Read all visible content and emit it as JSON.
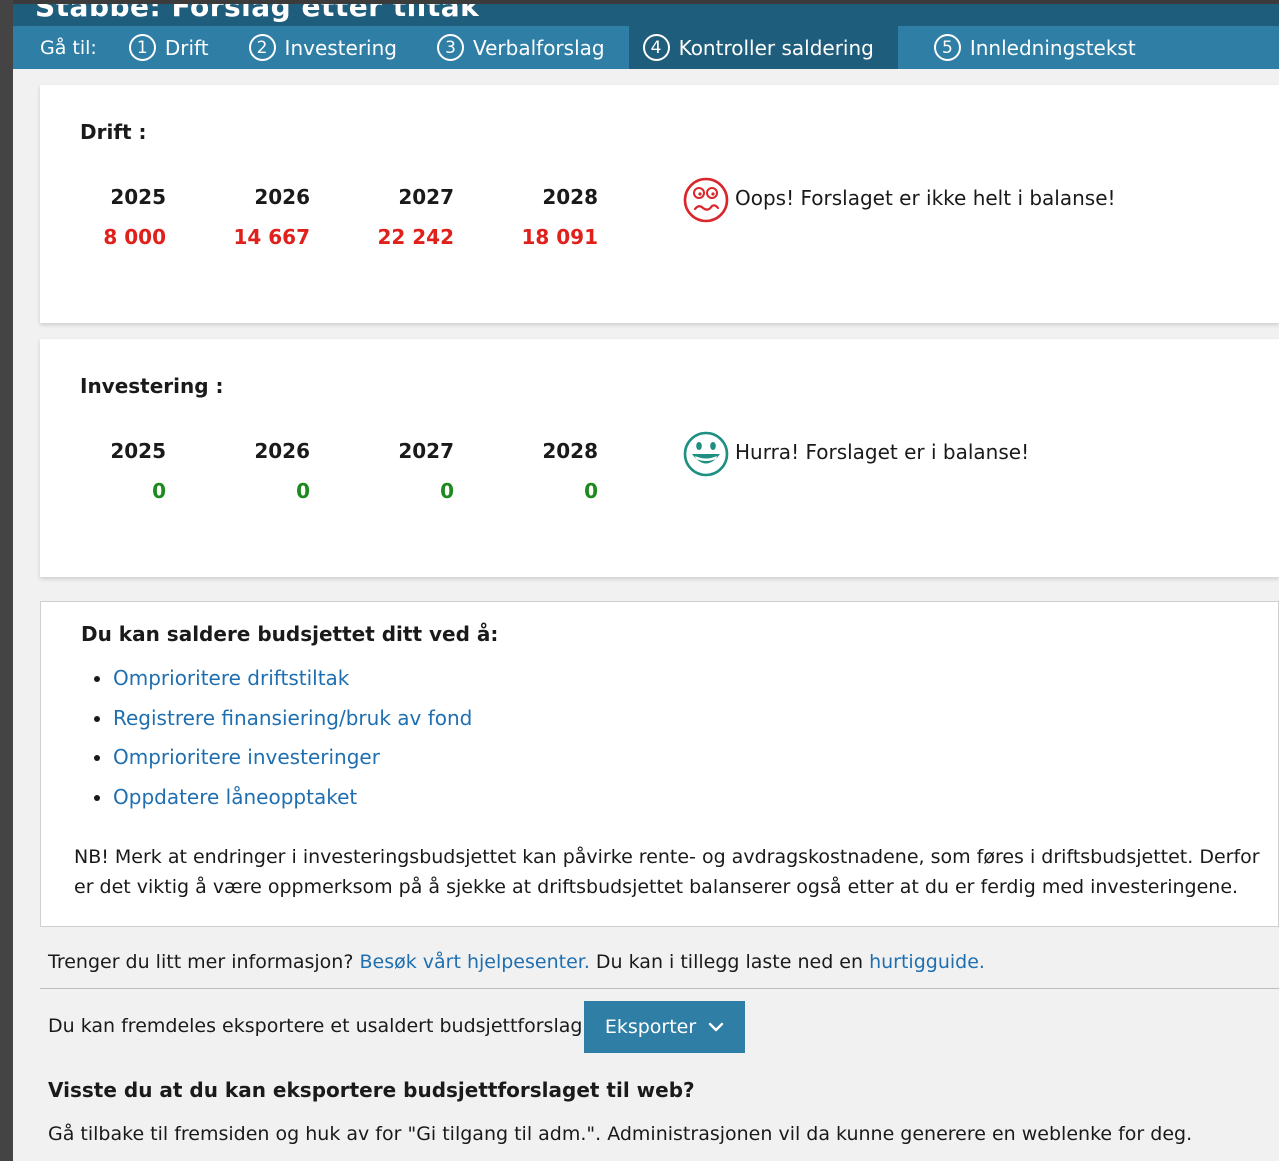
{
  "header": {
    "title": "Stabbe: Forslag etter tiltak"
  },
  "nav": {
    "goto_label": "Gå til:",
    "items": [
      {
        "num": "1",
        "label": "Drift"
      },
      {
        "num": "2",
        "label": "Investering"
      },
      {
        "num": "3",
        "label": "Verbalforslag"
      },
      {
        "num": "4",
        "label": "Kontroller saldering"
      },
      {
        "num": "5",
        "label": "Innledningstekst"
      }
    ],
    "active_index": 3
  },
  "drift": {
    "title": "Drift :",
    "years": [
      "2025",
      "2026",
      "2027",
      "2028"
    ],
    "values": [
      "8 000",
      "14 667",
      "22 242",
      "18 091"
    ],
    "value_color": "#e0201b",
    "status_icon": "sad-face-icon",
    "status_text": "Oops! Forslaget er ikke helt i balanse!"
  },
  "investering": {
    "title": "Investering :",
    "years": [
      "2025",
      "2026",
      "2027",
      "2028"
    ],
    "values": [
      "0",
      "0",
      "0",
      "0"
    ],
    "value_color": "#1c8a1c",
    "status_icon": "happy-face-icon",
    "status_text": "Hurra! Forslaget er i balanse!"
  },
  "info": {
    "title": "Du kan saldere budsjettet ditt ved å:",
    "tips": [
      "Omprioritere driftstiltak",
      "Registrere finansiering/bruk av fond",
      "Omprioritere investeringer",
      "Oppdatere låneopptaket"
    ],
    "nb": "NB! Merk at endringer i investeringsbudsjettet kan påvirke rente- og avdragskostnadene, som føres i driftsbudsjettet. Derfor er det viktig å være oppmerksom på å sjekke at driftsbudsjettet balanserer også etter at du er ferdig med investeringene."
  },
  "help": {
    "prefix": "Trenger du litt mer informasjon? ",
    "link1": "Besøk vårt hjelpesenter.",
    "middle": " Du kan i tillegg laste ned en ",
    "link2": "hurtigguide."
  },
  "export": {
    "text": "Du kan fremdeles eksportere et usaldert budsjettforslag.",
    "button_label": "Eksporter"
  },
  "web": {
    "title": "Visste du at du kan eksportere budsjettforslaget til web?",
    "text": "Gå tilbake til fremsiden og huk av for \"Gi tilgang til adm.\". Administrasjonen vil da kunne generere en weblenke for deg."
  },
  "colors": {
    "nav_bg": "#2e7ea6",
    "nav_active": "#1f5d7c",
    "link": "#1f6fb0",
    "sad": "#d9262a",
    "happy": "#1f8f82"
  }
}
